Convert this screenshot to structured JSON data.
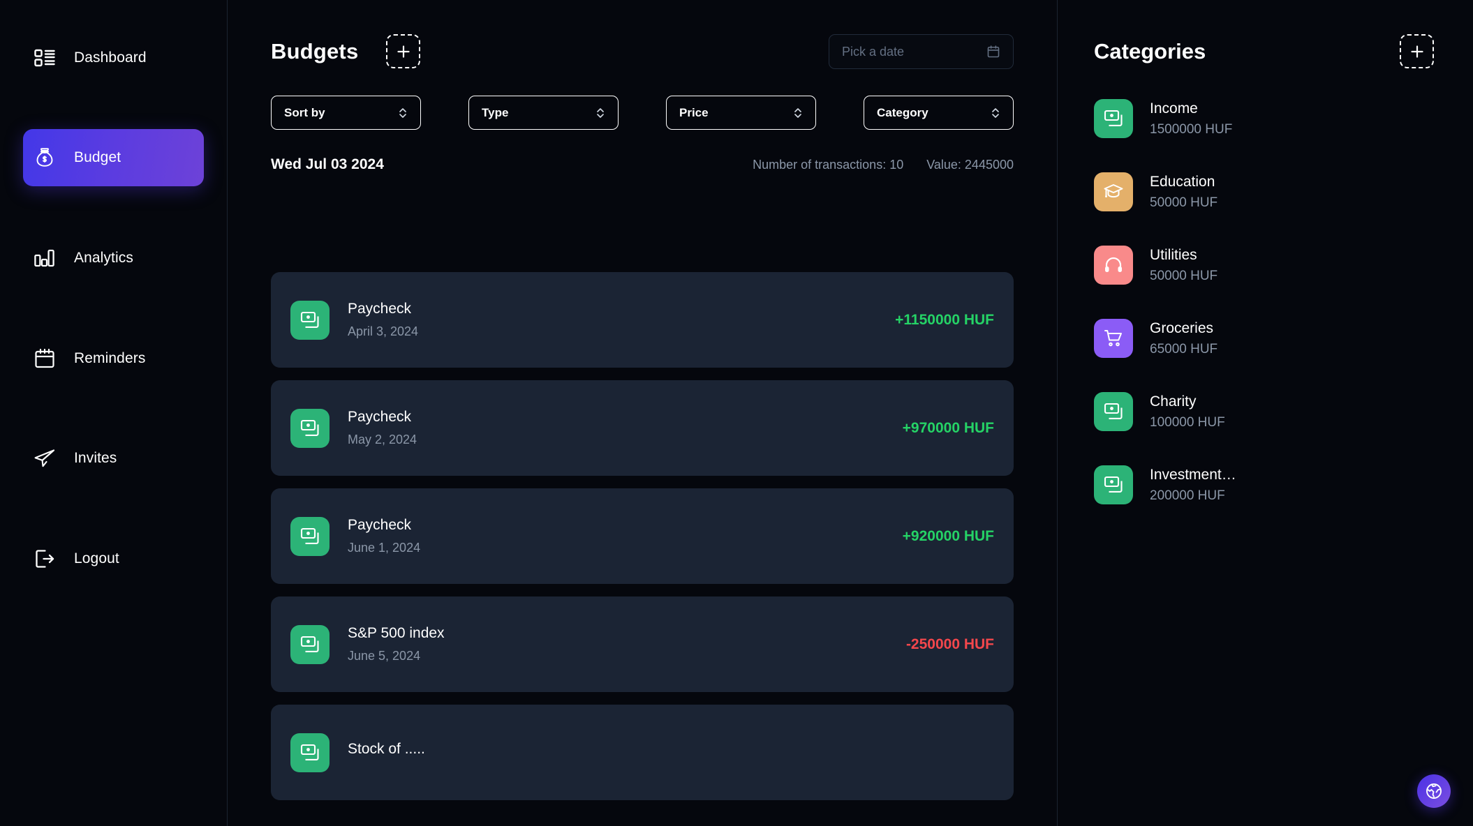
{
  "sidebar": {
    "items": [
      {
        "label": "Dashboard",
        "icon": "dashboard-icon",
        "active": false
      },
      {
        "label": "Budget",
        "icon": "money-bag-icon",
        "active": true
      },
      {
        "label": "Analytics",
        "icon": "bar-chart-icon",
        "active": false
      },
      {
        "label": "Reminders",
        "icon": "calendar-icon",
        "active": false
      },
      {
        "label": "Invites",
        "icon": "paper-plane-icon",
        "active": false
      },
      {
        "label": "Logout",
        "icon": "logout-icon",
        "active": false
      }
    ]
  },
  "main": {
    "title": "Budgets",
    "add_button_label": "+",
    "datepicker": {
      "placeholder": "Pick a date",
      "icon": "calendar-icon"
    },
    "filters": [
      {
        "label": "Sort by",
        "name": "sort-by"
      },
      {
        "label": "Type",
        "name": "type"
      },
      {
        "label": "Price",
        "name": "price"
      },
      {
        "label": "Category",
        "name": "category"
      }
    ],
    "summary": {
      "day": "Wed Jul 03 2024",
      "transactions": "Number of transactions: 10",
      "value": "Value: 2445000"
    },
    "transactions": [
      {
        "name": "Paycheck",
        "date": "April 3, 2024",
        "amount": "+1150000 HUF",
        "sign": "pos",
        "icon": "money-icon",
        "color": "#2cb377"
      },
      {
        "name": "Paycheck",
        "date": "May 2, 2024",
        "amount": "+970000 HUF",
        "sign": "pos",
        "icon": "money-icon",
        "color": "#2cb377"
      },
      {
        "name": "Paycheck",
        "date": "June 1, 2024",
        "amount": "+920000 HUF",
        "sign": "pos",
        "icon": "money-icon",
        "color": "#2cb377"
      },
      {
        "name": "S&P 500 index",
        "date": "June 5, 2024",
        "amount": "-250000 HUF",
        "sign": "neg",
        "icon": "money-icon",
        "color": "#2cb377"
      },
      {
        "name": "Stock of .....",
        "date": "",
        "amount": "",
        "sign": "pos",
        "icon": "money-icon",
        "color": "#2cb377"
      }
    ]
  },
  "categories": {
    "title": "Categories",
    "add_button_label": "+",
    "items": [
      {
        "name": "Income",
        "value": "1500000 HUF",
        "icon": "money-icon",
        "color": "#2cb377"
      },
      {
        "name": "Education",
        "value": "50000 HUF",
        "icon": "graduation-cap-icon",
        "color": "#e4b06a"
      },
      {
        "name": "Utilities",
        "value": "50000 HUF",
        "icon": "headphones-icon",
        "color": "#f98a8a"
      },
      {
        "name": "Groceries",
        "value": "65000 HUF",
        "icon": "shopping-cart-icon",
        "color": "#8b5cf6"
      },
      {
        "name": "Charity",
        "value": "100000 HUF",
        "icon": "money-icon",
        "color": "#2cb377"
      },
      {
        "name": "Investment…",
        "value": "200000 HUF",
        "icon": "money-icon",
        "color": "#2cb377"
      }
    ]
  },
  "fab": {
    "icon": "globe-icon"
  },
  "colors": {
    "accent_start": "#4338e8",
    "accent_end": "#6d42d8",
    "positive": "#25d366",
    "negative": "#f4474c",
    "card_bg": "#1b2434",
    "page_bg": "#05070d"
  }
}
